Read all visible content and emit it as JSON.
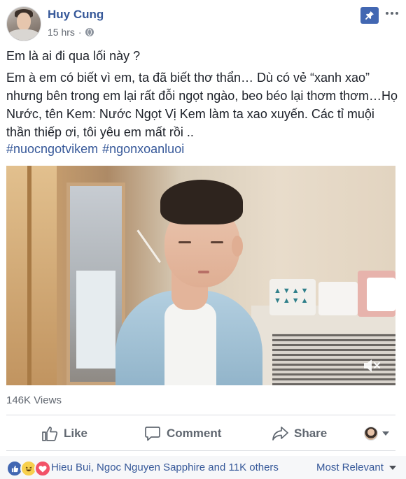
{
  "post": {
    "author": "Huy Cung",
    "time": "15 hrs",
    "separator": "·",
    "privacy_icon": "globe-icon",
    "text_line1": "Em là ai đi qua lối này ?",
    "text_body": "Em à em có biết vì em, ta đã biết thơ thẩn… Dù có vẻ “xanh xao” nhưng bên trong em lại rất đỗi ngọt ngào, beo béo lại thơm thơm…Họ Nước, tên Kem: Nước Ngọt Vị Kem làm ta xao xuyến. Các tỉ muội thần thiếp ơi, tôi yêu em mất rồi ..",
    "hashtags": [
      "#nuocngotvikem",
      "#ngonxoanluoi"
    ],
    "views": "146K Views"
  },
  "header_icons": {
    "pin": "pin-icon",
    "more": "more-options-icon"
  },
  "video": {
    "muted": true,
    "mute_icon": "volume-muted-icon"
  },
  "actions": {
    "like": "Like",
    "comment": "Comment",
    "share": "Share"
  },
  "reactions": {
    "types": [
      "like",
      "haha",
      "love"
    ],
    "summary": "Hieu Bui, Ngoc Nguyen Sapphire and 11K others",
    "sort": "Most Relevant"
  },
  "colors": {
    "link": "#365899",
    "pin_bg": "#4267b2",
    "text": "#1d2129",
    "muted_text": "#616770"
  }
}
